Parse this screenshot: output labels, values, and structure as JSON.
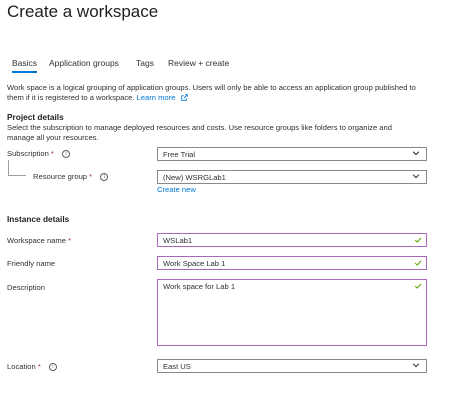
{
  "title": "Create a workspace",
  "tabs": [
    {
      "label": "Basics",
      "active": true
    },
    {
      "label": "Application groups",
      "active": false
    },
    {
      "label": "Tags",
      "active": false
    },
    {
      "label": "Review + create",
      "active": false
    }
  ],
  "intro": {
    "line1": "Work space is a logical grouping of application groups. Users will only be able to access an application group published to",
    "line2_prefix": "them if it is registered to a workspace. ",
    "learn_more": "Learn more"
  },
  "project": {
    "heading": "Project details",
    "desc_line1": "Select the subscription to manage deployed resources and costs. Use resource groups like folders to organize and",
    "desc_line2": "manage all your resources.",
    "subscription": {
      "label": "Subscription",
      "required": "*",
      "value": "Free Trial"
    },
    "resource_group": {
      "label": "Resource group",
      "required": "*",
      "value": "(New) WSRGLab1",
      "create_new": "Create new"
    }
  },
  "instance": {
    "heading": "Instance details",
    "workspace_name": {
      "label": "Workspace name",
      "required": "*",
      "value": "WSLab1"
    },
    "friendly_name": {
      "label": "Friendly name",
      "value": "Work Space Lab 1"
    },
    "description": {
      "label": "Description",
      "value": "Work space for Lab 1"
    },
    "location": {
      "label": "Location",
      "required": "*",
      "value": "East US"
    }
  },
  "colors": {
    "accent": "#0078d4",
    "valid_border": "#a86ab8",
    "valid_check": "#57a300",
    "required": "#a4262c"
  },
  "icons": {
    "info": "info-icon",
    "dropdown": "chevron-down-icon",
    "valid": "checkmark-icon",
    "external": "external-link-icon"
  }
}
